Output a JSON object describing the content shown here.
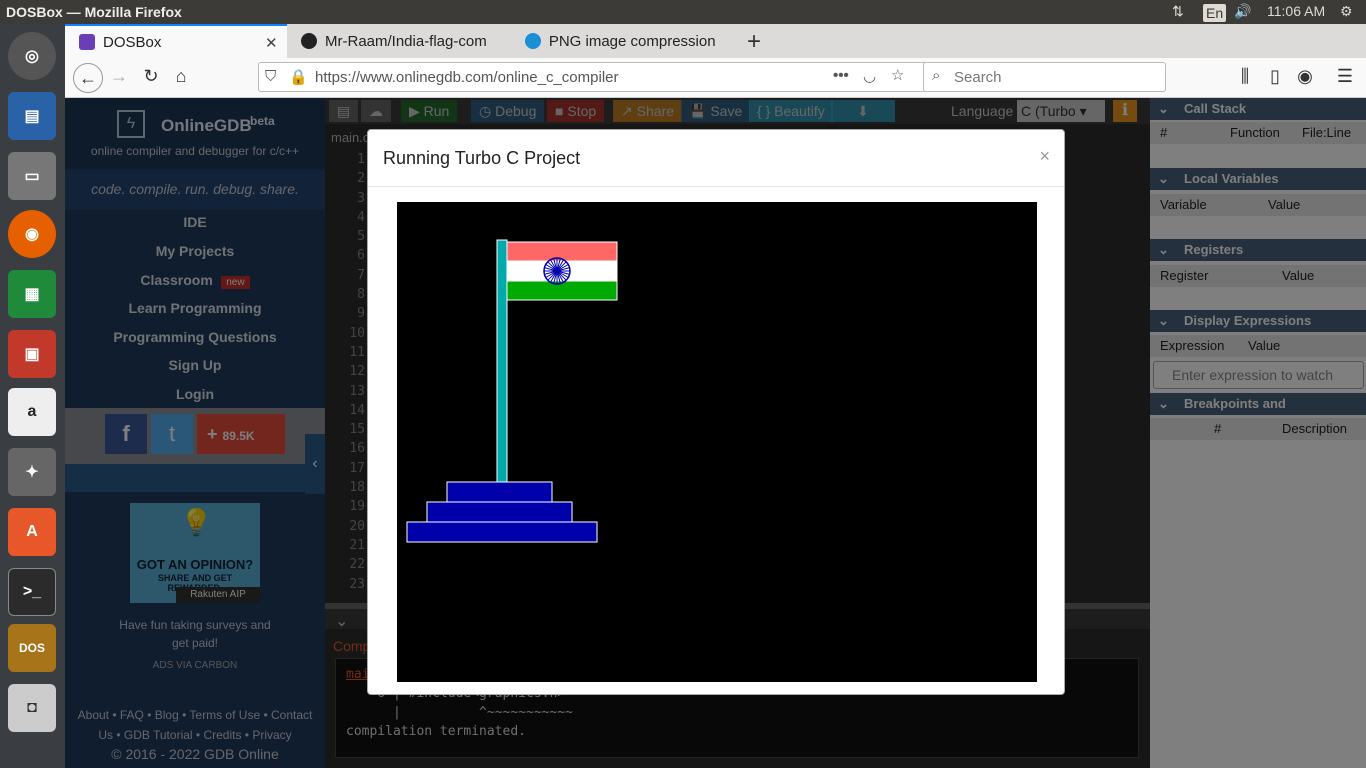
{
  "os": {
    "window_title": "DOSBox — Mozilla Firefox",
    "keyboard": "En",
    "time": "11:06 AM"
  },
  "browser": {
    "tabs": [
      {
        "label": "DOSBox",
        "active": true
      },
      {
        "label": "Mr-Raam/India-flag-com",
        "active": false
      },
      {
        "label": "PNG image compression",
        "active": false
      }
    ],
    "url": "https://www.onlinegdb.com/online_c_compiler",
    "search_placeholder": "Search"
  },
  "sidebar": {
    "brand": "OnlineGDB",
    "brand_sup": "beta",
    "tagline": "online compiler and debugger for c/c++",
    "motto": "code. compile. run. debug. share.",
    "nav": [
      "IDE",
      "My Projects",
      "Classroom",
      "Learn Programming",
      "Programming Questions",
      "Sign Up",
      "Login"
    ],
    "classroom_badge": "new",
    "share_count": "89.5K",
    "ad_headline": "GOT AN OPINION?",
    "ad_sub": "SHARE AND GET REWARDED.",
    "ad_brand": "Rakuten AIP",
    "ad_text": "Have fun taking surveys and get paid!",
    "ad_via": "ADS VIA CARBON",
    "footer_line1": "About • FAQ • Blog • Terms of Use • Contact",
    "footer_line2": "Us • GDB Tutorial • Credits • Privacy",
    "copyright": "© 2016 - 2022 GDB Online"
  },
  "toolbar": {
    "run": "Run",
    "debug": "Debug",
    "stop": "Stop",
    "share": "Share",
    "save": "Save",
    "beautify": "{ } Beautify",
    "language_label": "Language",
    "language_value": "C (Turbo"
  },
  "editor": {
    "file_tab": "main.c",
    "line_numbers": [
      "1",
      "2",
      "3",
      "4",
      "5",
      "6",
      "7",
      "8",
      "9",
      "10",
      "11",
      "12",
      "13",
      "14",
      "15",
      "16",
      "17",
      "18",
      "19",
      "20",
      "21",
      "22",
      "23"
    ]
  },
  "output": {
    "compile_label": "Comp",
    "file_ref": "mai",
    "line1": "    6 | #include<graphics.h>",
    "line2": "      |          ^~~~~~~~~~~~",
    "line3": "compilation terminated."
  },
  "debug_panel": {
    "call_stack": {
      "title": "Call Stack",
      "cols": [
        "#",
        "Function",
        "File:Line"
      ]
    },
    "local_vars": {
      "title": "Local Variables",
      "cols": [
        "Variable",
        "Value"
      ]
    },
    "registers": {
      "title": "Registers",
      "cols": [
        "Register",
        "Value"
      ]
    },
    "display_expr": {
      "title": "Display Expressions",
      "cols": [
        "Expression",
        "Value"
      ],
      "placeholder": "Enter expression to watch"
    },
    "breakpoints": {
      "title": "Breakpoints and Watchpoints",
      "cols": [
        "#",
        "Description"
      ]
    }
  },
  "modal": {
    "title": "Running Turbo C Project",
    "close": "×"
  },
  "colors": {
    "saffron": "#ff6666",
    "white": "#ffffff",
    "green": "#00aa00",
    "chakra": "#0000aa",
    "pole": "#00aaaa",
    "base": "#0000aa"
  }
}
